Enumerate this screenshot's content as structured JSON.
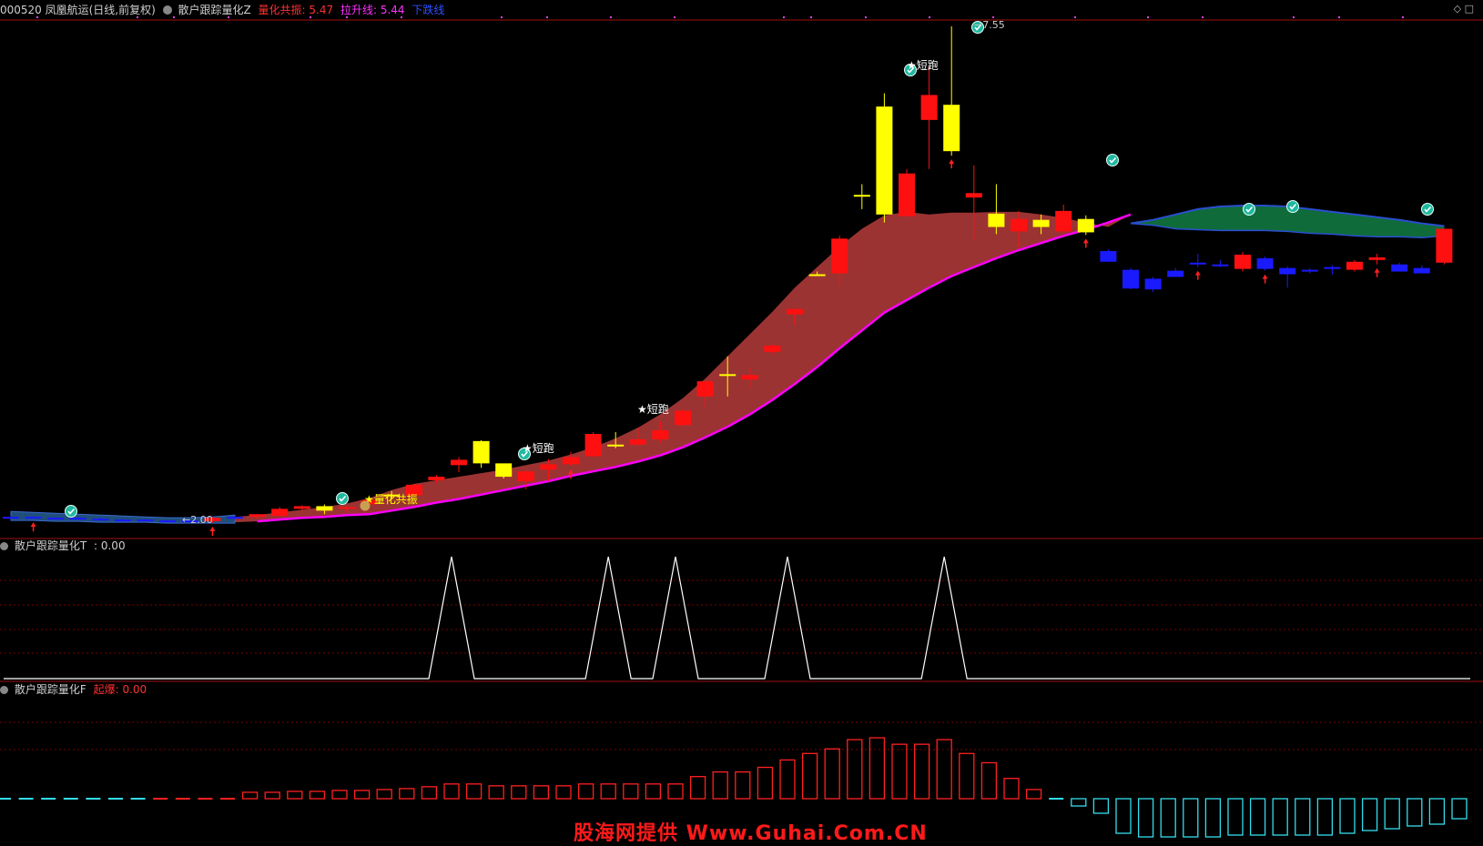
{
  "header": {
    "stock": "000520 凤凰航运(日线,前复权)",
    "indicator_name": "散户跟踪量化Z",
    "item1_label": "量化共振:",
    "item1_value": "5.47",
    "item2_label": "拉升线:",
    "item2_value": "5.44",
    "item3_label": "下跌线"
  },
  "panel2": {
    "title": "散户跟踪量化T",
    "value": ": 0.00"
  },
  "panel3": {
    "title": "散户跟踪量化F",
    "label": "起爆:",
    "value": "0.00"
  },
  "annotations": {
    "short_run": "★短跑",
    "resonance": "★量化共振",
    "low_value": "←2.00",
    "high_value": "→7.55"
  },
  "watermark": "股海网提供 Www.Guhai.Com.CN",
  "colors": {
    "up": "#ff1010",
    "down_yellow": "#ffff00",
    "down_blue": "#1a1aff",
    "magenta_line": "#ff00ff",
    "red_band": "#9b3333",
    "green_band": "#0f6b3a",
    "spike_line": "#ffffff",
    "cyan_bar": "#33ddee",
    "grid": "#7a0000"
  },
  "chart_data": [
    {
      "type": "candlestick",
      "title": "散户跟踪量化Z",
      "candles": [
        {
          "o": 2.05,
          "h": 2.06,
          "l": 2.04,
          "c": 2.05,
          "k": "blue"
        },
        {
          "o": 2.05,
          "h": 2.06,
          "l": 2.03,
          "c": 2.04,
          "k": "blue"
        },
        {
          "o": 2.04,
          "h": 2.05,
          "l": 2.03,
          "c": 2.04,
          "k": "blue"
        },
        {
          "o": 2.04,
          "h": 2.05,
          "l": 2.03,
          "c": 2.03,
          "k": "blue"
        },
        {
          "o": 2.03,
          "h": 2.04,
          "l": 2.02,
          "c": 2.02,
          "k": "blue"
        },
        {
          "o": 2.02,
          "h": 2.03,
          "l": 2.01,
          "c": 2.02,
          "k": "blue"
        },
        {
          "o": 2.02,
          "h": 2.03,
          "l": 2.01,
          "c": 2.01,
          "k": "blue"
        },
        {
          "o": 2.01,
          "h": 2.02,
          "l": 2.0,
          "c": 2.01,
          "k": "blue"
        },
        {
          "o": 2.01,
          "h": 2.02,
          "l": 2.0,
          "c": 2.0,
          "k": "blue"
        },
        {
          "o": 2.0,
          "h": 2.05,
          "l": 1.98,
          "c": 2.04,
          "k": "red"
        },
        {
          "o": 2.04,
          "h": 2.06,
          "l": 2.02,
          "c": 2.05,
          "k": "blue"
        },
        {
          "o": 2.05,
          "h": 2.08,
          "l": 2.03,
          "c": 2.08,
          "k": "red"
        },
        {
          "o": 2.06,
          "h": 2.16,
          "l": 2.05,
          "c": 2.14,
          "k": "red"
        },
        {
          "o": 2.14,
          "h": 2.18,
          "l": 2.12,
          "c": 2.17,
          "k": "red"
        },
        {
          "o": 2.17,
          "h": 2.19,
          "l": 2.08,
          "c": 2.12,
          "k": "yellow"
        },
        {
          "o": 2.14,
          "h": 2.17,
          "l": 2.1,
          "c": 2.16,
          "k": "red"
        },
        {
          "o": 2.19,
          "h": 2.26,
          "l": 2.17,
          "c": 2.24,
          "k": "red"
        },
        {
          "o": 2.3,
          "h": 2.34,
          "l": 2.26,
          "c": 2.28,
          "k": "yellow"
        },
        {
          "o": 2.29,
          "h": 2.42,
          "l": 2.28,
          "c": 2.41,
          "k": "red"
        },
        {
          "o": 2.46,
          "h": 2.52,
          "l": 2.43,
          "c": 2.5,
          "k": "red"
        },
        {
          "o": 2.63,
          "h": 2.72,
          "l": 2.55,
          "c": 2.69,
          "k": "red"
        },
        {
          "o": 2.9,
          "h": 2.91,
          "l": 2.6,
          "c": 2.65,
          "k": "yellow"
        },
        {
          "o": 2.5,
          "h": 2.58,
          "l": 2.48,
          "c": 2.65,
          "k": "yellow"
        },
        {
          "o": 2.45,
          "h": 2.57,
          "l": 2.36,
          "c": 2.56,
          "k": "red"
        },
        {
          "o": 2.58,
          "h": 2.7,
          "l": 2.45,
          "c": 2.64,
          "k": "red"
        },
        {
          "o": 2.64,
          "h": 2.78,
          "l": 2.62,
          "c": 2.72,
          "k": "red"
        },
        {
          "o": 2.73,
          "h": 3.0,
          "l": 2.72,
          "c": 2.98,
          "k": "red"
        },
        {
          "o": 2.86,
          "h": 3.0,
          "l": 2.82,
          "c": 2.84,
          "k": "yellow"
        },
        {
          "o": 2.86,
          "h": 3.05,
          "l": 2.84,
          "c": 2.92,
          "k": "red"
        },
        {
          "o": 2.92,
          "h": 3.12,
          "l": 2.88,
          "c": 3.02,
          "k": "red"
        },
        {
          "o": 3.08,
          "h": 3.26,
          "l": 3.06,
          "c": 3.24,
          "k": "red"
        },
        {
          "o": 3.4,
          "h": 3.58,
          "l": 3.28,
          "c": 3.57,
          "k": "red"
        },
        {
          "o": 3.65,
          "h": 3.85,
          "l": 3.4,
          "c": 3.63,
          "k": "yellow"
        },
        {
          "o": 3.59,
          "h": 3.72,
          "l": 3.5,
          "c": 3.64,
          "k": "red"
        },
        {
          "o": 3.9,
          "h": 3.98,
          "l": 3.88,
          "c": 3.97,
          "k": "red"
        },
        {
          "o": 4.32,
          "h": 4.39,
          "l": 4.2,
          "c": 4.38,
          "k": "red"
        },
        {
          "o": 4.77,
          "h": 4.8,
          "l": 4.77,
          "c": 4.77,
          "k": "yellow"
        },
        {
          "o": 4.78,
          "h": 5.2,
          "l": 4.65,
          "c": 5.17,
          "k": "red"
        },
        {
          "o": 5.65,
          "h": 5.78,
          "l": 5.5,
          "c": 5.66,
          "k": "yellow"
        },
        {
          "o": 6.65,
          "h": 6.8,
          "l": 5.35,
          "c": 5.44,
          "k": "yellow"
        },
        {
          "o": 5.42,
          "h": 5.95,
          "l": 5.42,
          "c": 5.9,
          "k": "red"
        },
        {
          "o": 6.5,
          "h": 7.1,
          "l": 5.95,
          "c": 6.78,
          "k": "red"
        },
        {
          "o": 6.67,
          "h": 7.55,
          "l": 6.1,
          "c": 6.15,
          "k": "yellow"
        },
        {
          "o": 5.63,
          "h": 5.99,
          "l": 5.16,
          "c": 5.68,
          "k": "red"
        },
        {
          "o": 5.45,
          "h": 5.78,
          "l": 5.22,
          "c": 5.3,
          "k": "yellow"
        },
        {
          "o": 5.25,
          "h": 5.48,
          "l": 5.07,
          "c": 5.39,
          "k": "red"
        },
        {
          "o": 5.38,
          "h": 5.44,
          "l": 5.22,
          "c": 5.3,
          "k": "yellow"
        },
        {
          "o": 5.25,
          "h": 5.55,
          "l": 5.2,
          "c": 5.48,
          "k": "red"
        },
        {
          "o": 5.39,
          "h": 5.43,
          "l": 5.21,
          "c": 5.24,
          "k": "yellow"
        },
        {
          "o": 5.03,
          "h": 5.05,
          "l": 4.95,
          "c": 4.91,
          "k": "blue"
        },
        {
          "o": 4.82,
          "h": 4.84,
          "l": 4.6,
          "c": 4.61,
          "k": "blue"
        },
        {
          "o": 4.72,
          "h": 4.74,
          "l": 4.57,
          "c": 4.6,
          "k": "blue"
        },
        {
          "o": 4.81,
          "h": 4.84,
          "l": 4.75,
          "c": 4.74,
          "k": "blue"
        },
        {
          "o": 4.9,
          "h": 5.0,
          "l": 4.85,
          "c": 4.89,
          "k": "blue"
        },
        {
          "o": 4.88,
          "h": 4.93,
          "l": 4.85,
          "c": 4.87,
          "k": "blue"
        },
        {
          "o": 4.83,
          "h": 5.02,
          "l": 4.8,
          "c": 4.99,
          "k": "red"
        },
        {
          "o": 4.95,
          "h": 4.97,
          "l": 4.81,
          "c": 4.83,
          "k": "blue"
        },
        {
          "o": 4.84,
          "h": 4.86,
          "l": 4.62,
          "c": 4.77,
          "k": "blue"
        },
        {
          "o": 4.82,
          "h": 4.84,
          "l": 4.78,
          "c": 4.8,
          "k": "blue"
        },
        {
          "o": 4.85,
          "h": 4.87,
          "l": 4.77,
          "c": 4.83,
          "k": "blue"
        },
        {
          "o": 4.82,
          "h": 4.93,
          "l": 4.8,
          "c": 4.91,
          "k": "red"
        },
        {
          "o": 4.93,
          "h": 5.0,
          "l": 4.88,
          "c": 4.96,
          "k": "red"
        },
        {
          "o": 4.88,
          "h": 4.9,
          "l": 4.8,
          "c": 4.8,
          "k": "blue"
        },
        {
          "o": 4.84,
          "h": 4.87,
          "l": 4.79,
          "c": 4.78,
          "k": "blue"
        },
        {
          "o": 4.9,
          "h": 5.28,
          "l": 4.88,
          "c": 5.28,
          "k": "red"
        }
      ],
      "lift_line": [
        2.02,
        2.02,
        2.01,
        2.01,
        2.0,
        2.0,
        2.0,
        1.99,
        1.99,
        1.99,
        1.99,
        2.0,
        2.02,
        2.04,
        2.05,
        2.07,
        2.08,
        2.12,
        2.16,
        2.21,
        2.25,
        2.3,
        2.35,
        2.4,
        2.45,
        2.51,
        2.56,
        2.61,
        2.67,
        2.74,
        2.83,
        2.94,
        3.06,
        3.2,
        3.36,
        3.54,
        3.73,
        3.94,
        4.14,
        4.34,
        4.48,
        4.62,
        4.75,
        4.85,
        4.95,
        5.04,
        5.12,
        5.2,
        5.27,
        5.35,
        5.44
      ],
      "band_upper": [
        2.09,
        2.08,
        2.07,
        2.06,
        2.05,
        2.04,
        2.03,
        2.02,
        2.02,
        2.03,
        2.05,
        2.07,
        2.1,
        2.13,
        2.16,
        2.2,
        2.26,
        2.35,
        2.42,
        2.46,
        2.5,
        2.54,
        2.58,
        2.63,
        2.68,
        2.75,
        2.83,
        2.93,
        3.05,
        3.2,
        3.38,
        3.6,
        3.85,
        4.1,
        4.35,
        4.62,
        4.85,
        5.08,
        5.28,
        5.43,
        5.47,
        5.44,
        5.46,
        5.46,
        5.47,
        5.47,
        5.44,
        5.4,
        5.35,
        5.3
      ],
      "green_upper": [
        5.34,
        5.38,
        5.44,
        5.5,
        5.53,
        5.54,
        5.54,
        5.53,
        5.5,
        5.47,
        5.44,
        5.41,
        5.38,
        5.34,
        5.31
      ],
      "green_lower": [
        5.34,
        5.32,
        5.28,
        5.27,
        5.26,
        5.26,
        5.26,
        5.25,
        5.23,
        5.22,
        5.2,
        5.19,
        5.19,
        5.18,
        5.2
      ],
      "ylim": [
        1.95,
        7.6
      ],
      "short_run_marks": [
        22,
        28,
        39
      ],
      "resonance_mark": 15
    },
    {
      "type": "line",
      "title": "散户跟踪量化T",
      "spike_centers": [
        20,
        27,
        30,
        35,
        42
      ],
      "spike_value": 1,
      "ylim": [
        0,
        1
      ]
    },
    {
      "type": "bar",
      "title": "散户跟踪量化F",
      "values": [
        0.02,
        0.02,
        0.02,
        0.02,
        0.02,
        0.02,
        0.02,
        0.02,
        0.02,
        0.02,
        0.02,
        0.03,
        0.03,
        0.04,
        0.04,
        0.05,
        0.05,
        0.06,
        0.07,
        0.09,
        0.12,
        0.12,
        0.1,
        0.1,
        0.1,
        0.1,
        0.12,
        0.12,
        0.12,
        0.12,
        0.12,
        0.2,
        0.25,
        0.25,
        0.3,
        0.38,
        0.45,
        0.5,
        0.6,
        0.62,
        0.55,
        0.55,
        0.6,
        0.45,
        0.35,
        0.18,
        0.06,
        -0.02,
        -0.08,
        -0.16,
        -0.38,
        -0.42,
        -0.42,
        -0.42,
        -0.42,
        -0.4,
        -0.4,
        -0.4,
        -0.4,
        -0.4,
        -0.38,
        -0.35,
        -0.33,
        -0.3,
        -0.28,
        -0.22
      ],
      "colors": [
        "cyan",
        "cyan",
        "cyan",
        "cyan",
        "cyan",
        "cyan",
        "cyan",
        "red",
        "red",
        "red",
        "red",
        "red",
        "red",
        "red",
        "red",
        "red",
        "red",
        "red",
        "red",
        "red",
        "red",
        "red",
        "red",
        "red",
        "red",
        "red",
        "red",
        "red",
        "red",
        "red",
        "red",
        "red",
        "red",
        "red",
        "red",
        "red",
        "red",
        "red",
        "red",
        "red",
        "red",
        "red",
        "red",
        "red",
        "red",
        "red",
        "red",
        "cyan",
        "cyan",
        "cyan",
        "cyan",
        "cyan",
        "cyan",
        "cyan",
        "cyan",
        "cyan",
        "cyan",
        "cyan",
        "cyan",
        "cyan",
        "cyan",
        "cyan",
        "cyan",
        "cyan",
        "cyan",
        "cyan"
      ],
      "ylim": [
        -0.45,
        0.65
      ]
    }
  ]
}
